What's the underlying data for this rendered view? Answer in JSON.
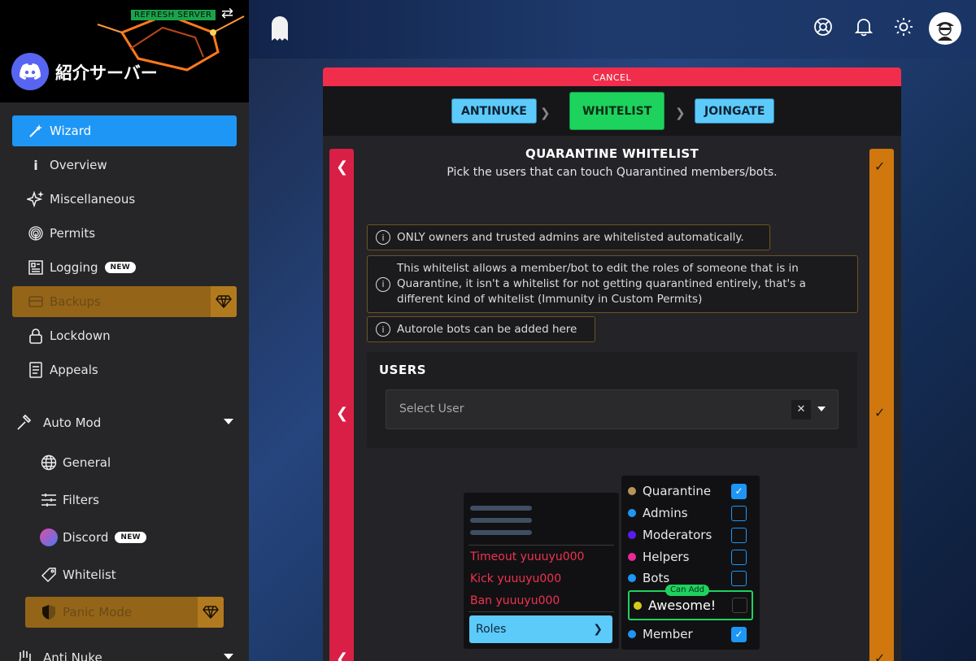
{
  "server": {
    "name": "紹介サーバー",
    "refresh_label": "REFRESH SERVER"
  },
  "nav": {
    "wizard": "Wizard",
    "overview": "Overview",
    "misc": "Miscellaneous",
    "permits": "Permits",
    "logging": "Logging",
    "logging_badge": "NEW",
    "backups": "Backups",
    "lockdown": "Lockdown",
    "appeals": "Appeals",
    "automod": "Auto Mod",
    "general": "General",
    "filters": "Filters",
    "discord": "Discord",
    "discord_badge": "NEW",
    "whitelist": "Whitelist",
    "panic": "Panic Mode",
    "antinuke": "Anti Nuke"
  },
  "icons": {
    "wizard": "magic-wand-icon",
    "overview": "info-icon",
    "misc": "sparkles-icon",
    "permits": "fingerprint-icon",
    "logging": "newspaper-icon",
    "backups": "backup-icon",
    "lockdown": "lock-icon",
    "appeals": "document-icon",
    "automod": "hammer-icon",
    "general": "globe-icon",
    "filters": "sliders-icon",
    "discord": "discord-avatar-icon",
    "whitelist": "tag-icon",
    "panic": "shield-icon",
    "antinuke": "hand-icon",
    "premium": "diamond-icon"
  },
  "colors": {
    "accent_blue": "#1e96f5",
    "green": "#1ed25e",
    "cancel_red": "#f12d4c",
    "premium": "#946518"
  },
  "wizard": {
    "cancel": "CANCEL",
    "steps": [
      "ANTINUKE",
      "WHITELIST",
      "JOINGATE"
    ],
    "title": "QUARANTINE WHITELIST",
    "subtitle": "Pick the users that can touch Quarantined members/bots.",
    "notes": [
      "ONLY owners and trusted admins are whitelisted automatically.",
      "This whitelist allows a member/bot to edit the roles of someone that is in Quarantine, it isn't a whitelist for not getting quarantined entirely, that's a different kind of whitelist (Immunity in Custom Permits)",
      "Autorole bots can be added here"
    ],
    "users_title": "USERS",
    "select_placeholder": "Select User",
    "clear": "✕"
  },
  "context_menu": {
    "items": [
      "Timeout yuuuyu000",
      "Kick yuuuyu000",
      "Ban yuuuyu000"
    ],
    "roles": "Roles"
  },
  "roles": [
    {
      "name": "Quarantine",
      "color": "#b8935a",
      "checked": true
    },
    {
      "name": "Admins",
      "color": "#1e96f5",
      "checked": false
    },
    {
      "name": "Moderators",
      "color": "#5a1df0",
      "checked": false
    },
    {
      "name": "Helpers",
      "color": "#e82a9a",
      "checked": false
    },
    {
      "name": "Bots",
      "color": "#1e96f5",
      "checked": false
    },
    {
      "name": "Awesome!",
      "color": "#d4cc1a",
      "checked": false,
      "tag": "Can Add"
    },
    {
      "name": "Member",
      "color": "#1e96f5",
      "checked": true
    }
  ]
}
